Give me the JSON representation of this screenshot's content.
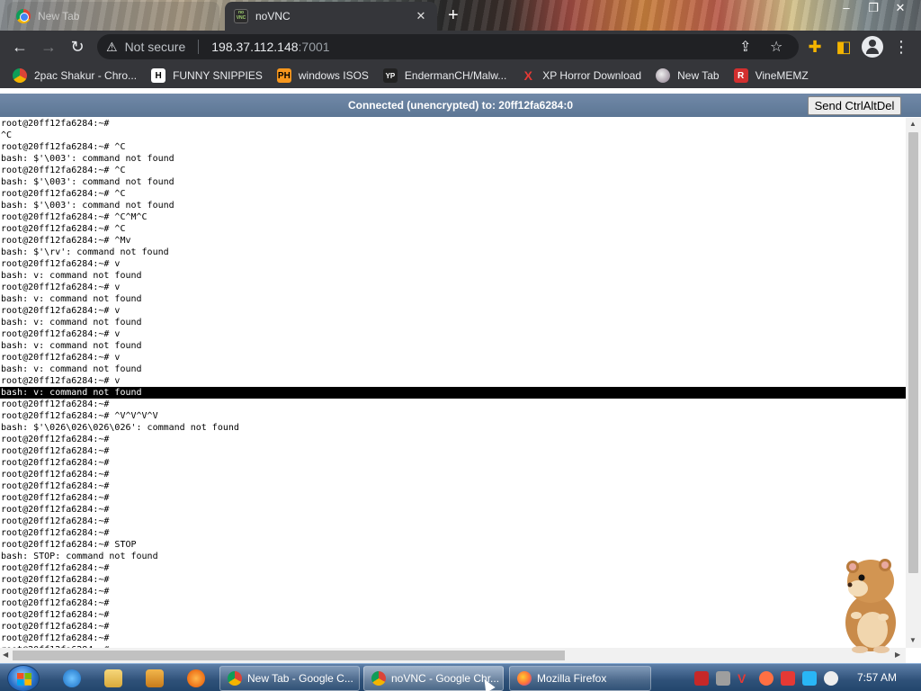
{
  "browser": {
    "tabs": [
      {
        "title": "New Tab",
        "active": false,
        "icon": "chrome-icon"
      },
      {
        "title": "noVNC",
        "active": true,
        "icon": "novnc-icon"
      }
    ],
    "new_tab_symbol": "+",
    "window_controls": {
      "minimize": "–",
      "maximize": "❐",
      "close": "✕"
    },
    "security_label": "Not secure",
    "address_host": "198.37.112.148",
    "address_port": ":7001",
    "bookmarks": [
      {
        "label": "2pac Shakur - Chro...",
        "icon": "chrome-icon",
        "color": "#db4437"
      },
      {
        "label": "FUNNY SNIPPIES",
        "icon": "h-icon",
        "color": "#ffffff"
      },
      {
        "label": "windows ISOS",
        "icon": "ph-icon",
        "color": "#f7971d"
      },
      {
        "label": "EndermanCH/Malw...",
        "icon": "yp-icon",
        "color": "#222222"
      },
      {
        "label": "XP Horror Download",
        "icon": "x-icon",
        "color": "#e53935"
      },
      {
        "label": "New Tab",
        "icon": "globe-icon",
        "color": "#9aa0a6"
      },
      {
        "label": "VineMEMZ",
        "icon": "r-icon",
        "color": "#d32f2f"
      }
    ]
  },
  "novnc": {
    "status": "Connected (unencrypted) to: 20ff12fa6284:0",
    "ctrl_alt_del_label": "Send CtrlAltDel"
  },
  "terminal": {
    "highlighted_line": 23,
    "lines": [
      "root@20ff12fa6284:~#",
      "^C",
      "root@20ff12fa6284:~# ^C",
      "bash: $'\\003': command not found",
      "root@20ff12fa6284:~# ^C",
      "bash: $'\\003': command not found",
      "root@20ff12fa6284:~# ^C",
      "bash: $'\\003': command not found",
      "root@20ff12fa6284:~# ^C^M^C",
      "root@20ff12fa6284:~# ^C",
      "root@20ff12fa6284:~# ^Mv",
      "bash: $'\\rv': command not found",
      "root@20ff12fa6284:~# v",
      "bash: v: command not found",
      "root@20ff12fa6284:~# v",
      "bash: v: command not found",
      "root@20ff12fa6284:~# v",
      "bash: v: command not found",
      "root@20ff12fa6284:~# v",
      "bash: v: command not found",
      "root@20ff12fa6284:~# v",
      "bash: v: command not found",
      "root@20ff12fa6284:~# v",
      "bash: v: command not found",
      "root@20ff12fa6284:~#",
      "root@20ff12fa6284:~# ^V^V^V^V",
      "bash: $'\\026\\026\\026\\026': command not found",
      "root@20ff12fa6284:~#",
      "root@20ff12fa6284:~#",
      "root@20ff12fa6284:~#",
      "root@20ff12fa6284:~#",
      "root@20ff12fa6284:~#",
      "root@20ff12fa6284:~#",
      "root@20ff12fa6284:~#",
      "root@20ff12fa6284:~#",
      "root@20ff12fa6284:~#",
      "root@20ff12fa6284:~# STOP",
      "bash: STOP: command not found",
      "root@20ff12fa6284:~#",
      "root@20ff12fa6284:~#",
      "root@20ff12fa6284:~#",
      "root@20ff12fa6284:~#",
      "root@20ff12fa6284:~#",
      "root@20ff12fa6284:~#",
      "root@20ff12fa6284:~#",
      "root@20ff12fa6284:~#"
    ]
  },
  "taskbar": {
    "buttons": [
      {
        "label": "New Tab - Google C...",
        "icon": "chrome-icon",
        "active": false
      },
      {
        "label": "noVNC - Google Chr...",
        "icon": "chrome-icon",
        "active": true
      },
      {
        "label": "Mozilla Firefox",
        "icon": "firefox-icon",
        "active": false
      }
    ],
    "clock": "7:57 AM"
  },
  "colors": {
    "browser_chrome": "#35363a",
    "novnc_bar": "#6883a3",
    "terminal_highlight": "#000000",
    "taskbar": "#2f5179"
  }
}
